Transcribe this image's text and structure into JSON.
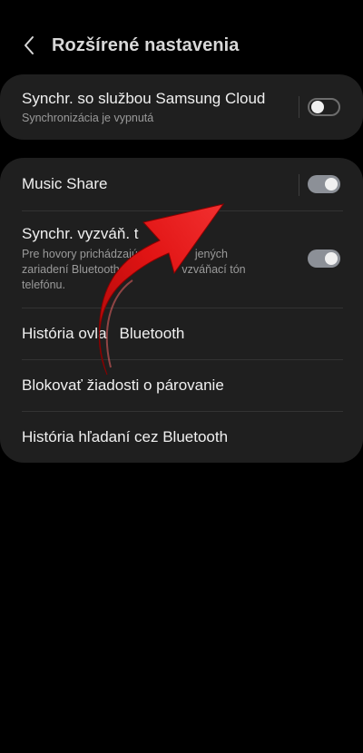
{
  "header": {
    "title": "Rozšírené nastavenia",
    "back_icon": "chevron-left-icon"
  },
  "cloud_sync": {
    "title": "Synchr. so službou Samsung Cloud",
    "subtitle": "Synchronizácia je vypnutá",
    "enabled": false
  },
  "settings": {
    "music_share": {
      "title": "Music Share",
      "enabled": true
    },
    "ringtone_sync": {
      "title": "Synchr. vyzváň. t",
      "desc_line1": "Pre hovory prichádzajú",
      "desc_line1b": "jených",
      "desc_line2": "zariadení Bluetooth s",
      "desc_line2b": "vzváňací tón",
      "desc_line3": "telefónu.",
      "enabled": true
    },
    "control_history": {
      "title_a": "História ovla",
      "title_b": "Bluetooth"
    },
    "block_pairing": {
      "title": "Blokovať žiadosti o párovanie"
    },
    "search_history": {
      "title": "História hľadaní cez Bluetooth"
    }
  },
  "colors": {
    "background": "#000000",
    "card": "#1f1f1f",
    "switch_on": "#8c9097",
    "overlay_arrow": "#e11414"
  },
  "overlay": {
    "icon": "red-curved-arrow-icon"
  }
}
